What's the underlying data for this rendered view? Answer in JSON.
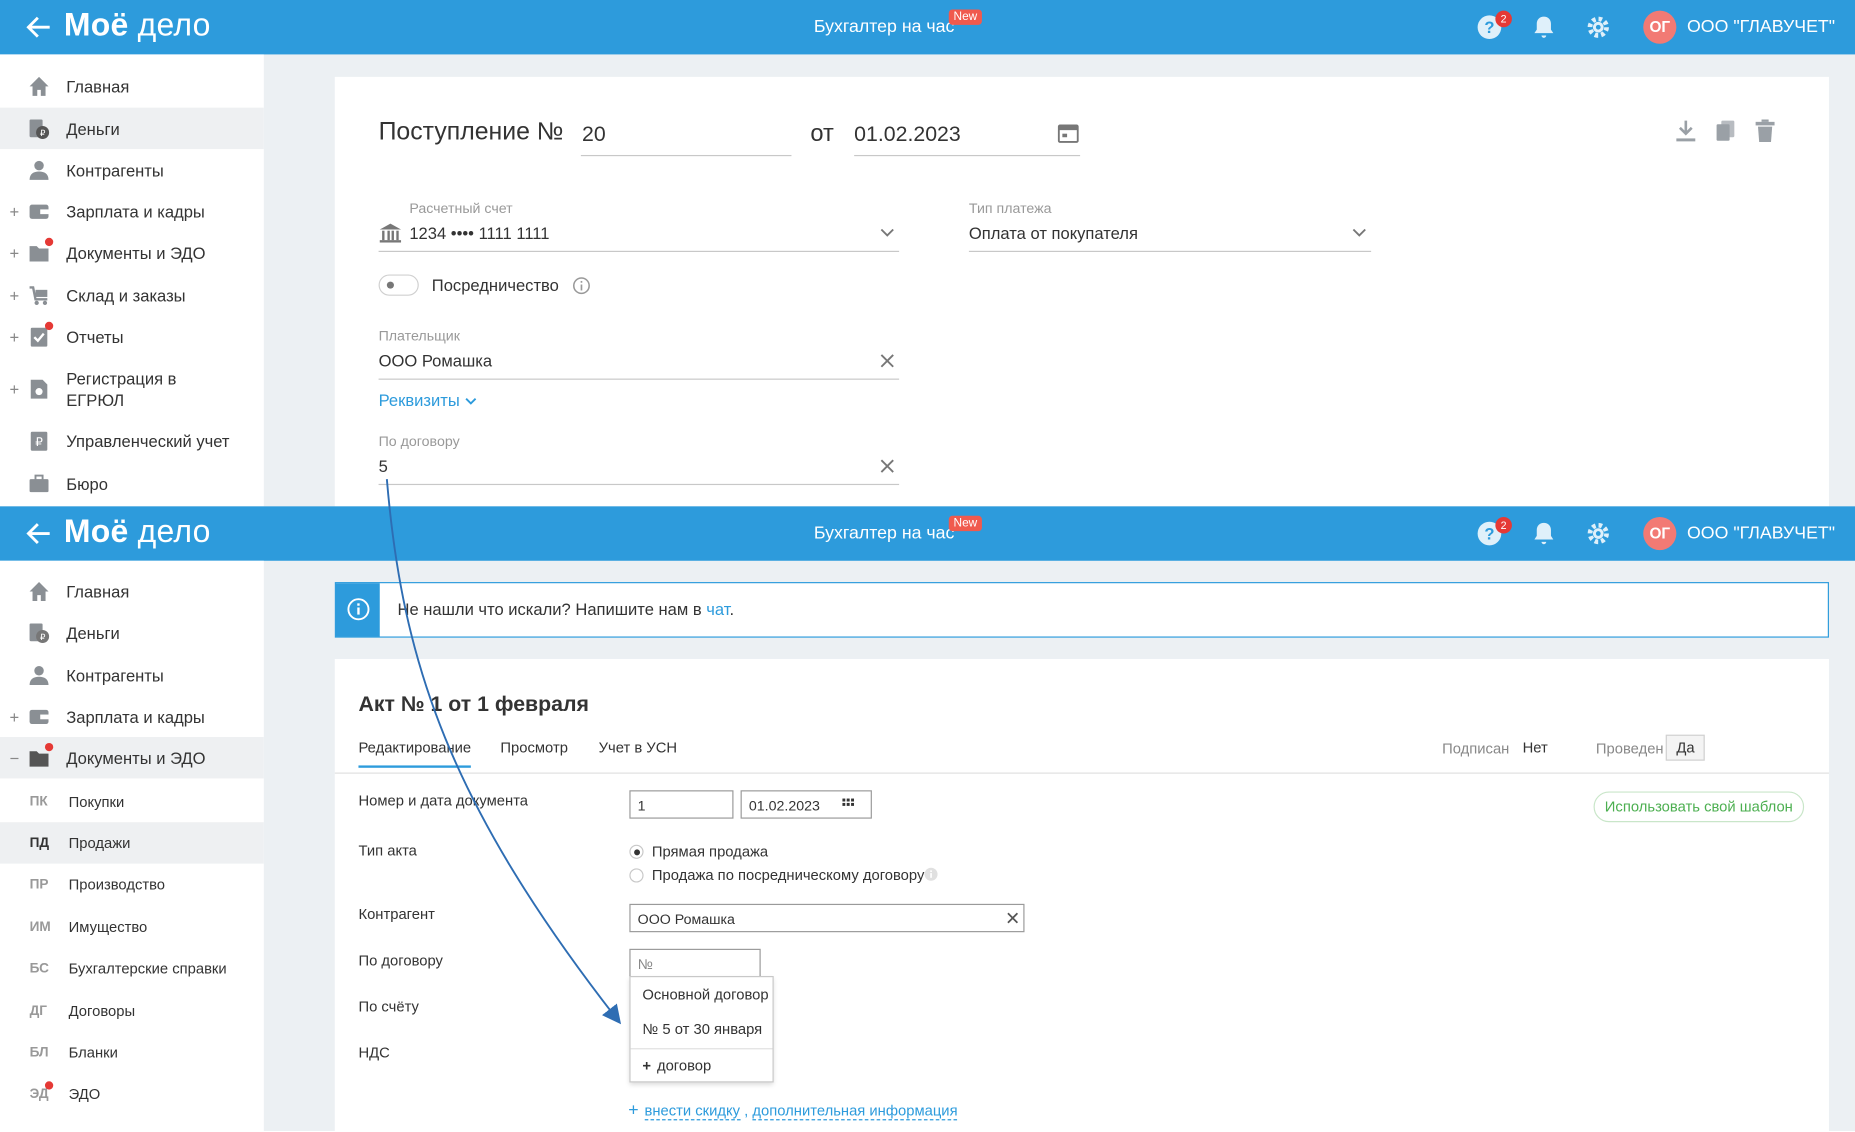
{
  "header": {
    "logo_bold": "Моё",
    "logo_light": "дело",
    "center_link": "Бухгалтер на час",
    "new_badge": "New",
    "help_count": "2",
    "avatar_initials": "ОГ",
    "company": "ООО \"ГЛАВУЧЕТ\""
  },
  "sidebar1": {
    "items": [
      {
        "label": "Главная"
      },
      {
        "label": "Деньги"
      },
      {
        "label": "Контрагенты"
      },
      {
        "label": "Зарплата и кадры"
      },
      {
        "label": "Документы и ЭДО"
      },
      {
        "label": "Склад и заказы"
      },
      {
        "label": "Отчеты"
      },
      {
        "label": "Регистрация в ЕГРЮЛ"
      },
      {
        "label": "Управленческий учет"
      },
      {
        "label": "Бюро"
      }
    ]
  },
  "payment": {
    "title": "Поступление №",
    "number": "20",
    "from_label": "от",
    "date": "01.02.2023",
    "account_label": "Расчетный счет",
    "account_value": "1234 •••• 1111 1111",
    "type_label": "Тип платежа",
    "type_value": "Оплата от покупателя",
    "mediation_label": "Посредничество",
    "payer_label": "Плательщик",
    "payer_value": "ООО Ромашка",
    "details_link": "Реквизиты",
    "contract_label": "По договору",
    "contract_value": "5"
  },
  "sidebar2": {
    "items": [
      {
        "label": "Главная"
      },
      {
        "label": "Деньги"
      },
      {
        "label": "Контрагенты"
      },
      {
        "label": "Зарплата и кадры"
      },
      {
        "label": "Документы и ЭДО"
      }
    ],
    "sub_items": [
      {
        "abbr": "ПК",
        "label": "Покупки"
      },
      {
        "abbr": "ПД",
        "label": "Продажи"
      },
      {
        "abbr": "ПР",
        "label": "Производство"
      },
      {
        "abbr": "ИМ",
        "label": "Имущество"
      },
      {
        "abbr": "БС",
        "label": "Бухгалтерские справки"
      },
      {
        "abbr": "ДГ",
        "label": "Договоры"
      },
      {
        "abbr": "БЛ",
        "label": "Бланки"
      },
      {
        "abbr": "ЭД",
        "label": "ЭДО"
      }
    ]
  },
  "info": {
    "text": "Не нашли что искали? Напишите нам в",
    "link": "чат",
    "tail": "."
  },
  "act": {
    "title": "Акт № 1 от 1 февраля",
    "tabs": [
      "Редактирование",
      "Просмотр",
      "Учет в УСН"
    ],
    "signed_label": "Подписан",
    "signed_value": "Нет",
    "posted_label": "Проведен",
    "posted_value": "Да",
    "template_button": "Использовать свой шаблон",
    "doc_label": "Номер и дата документа",
    "doc_number": "1",
    "doc_date": "01.02.2023",
    "type_label": "Тип акта",
    "type_options": [
      "Прямая продажа",
      "Продажа по посредническому договору"
    ],
    "counterparty_label": "Контрагент",
    "counterparty_value": "ООО Ромашка",
    "contract_label": "По договору",
    "contract_placeholder": "№",
    "invoice_label": "По счёту",
    "vat_label": "НДС",
    "dropdown": [
      "Основной договор",
      "№ 5 от 30 января",
      "договор"
    ],
    "discount_link": "внести скидку",
    "sep": ",",
    "extra_link": "дополнительная информация"
  },
  "colors": {
    "brand": "#2d9bdc",
    "badge": "#f05a4e",
    "avatar": "#f27a74",
    "template_green": "#4caf50"
  }
}
